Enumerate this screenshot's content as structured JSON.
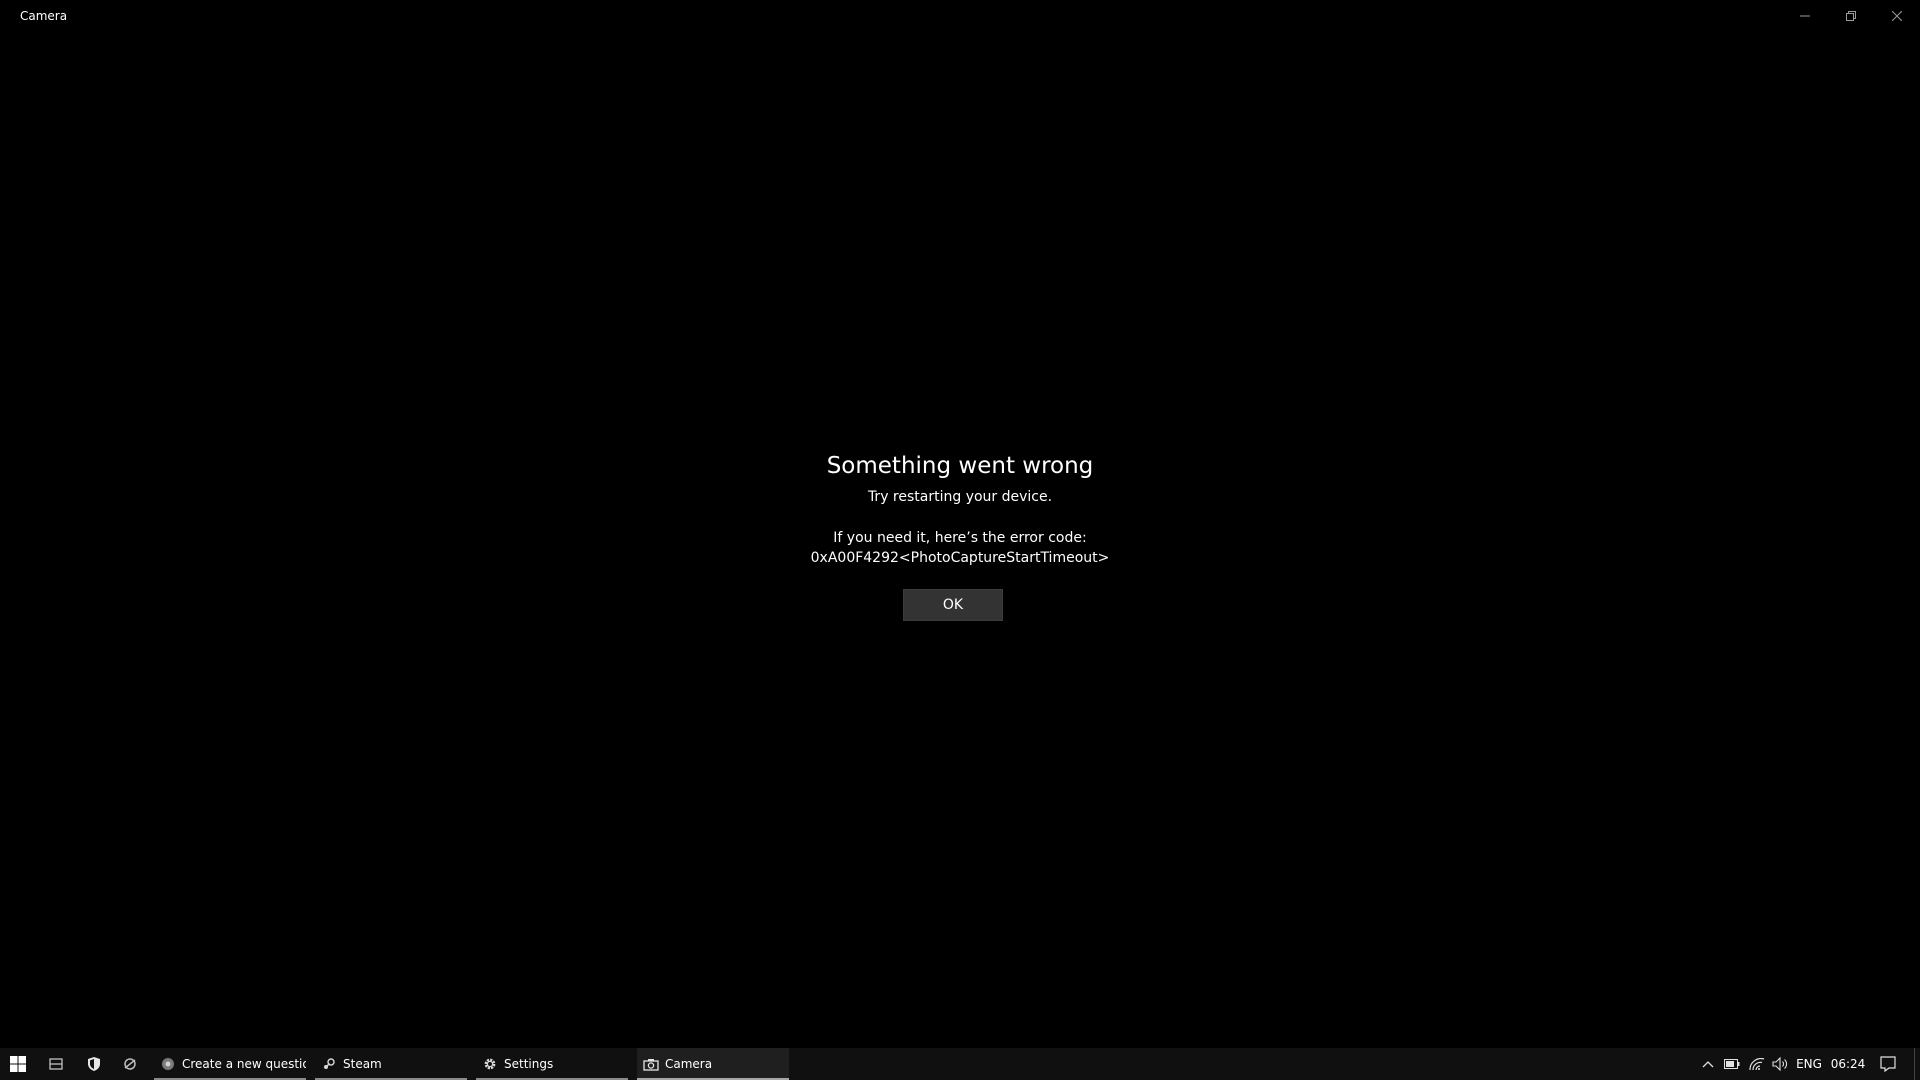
{
  "window": {
    "title": "Camera",
    "controls": {
      "minimize": "minimize-icon",
      "restore": "restore-icon",
      "close": "close-icon"
    }
  },
  "error": {
    "title": "Something went wrong",
    "subtitle": "Try restarting your device.",
    "code_label": "If you need it, here’s the error code:",
    "code": "0xA00F4292<PhotoCaptureStartTimeout>",
    "ok_label": "OK"
  },
  "taskbar": {
    "pinned": [
      {
        "icon": "windows-start-icon"
      },
      {
        "icon": "task-view-icon"
      },
      {
        "icon": "security-shield-icon"
      },
      {
        "icon": "app-icon"
      }
    ],
    "apps": [
      {
        "label": "Create a new questio...",
        "icon": "browser-icon",
        "active": false
      },
      {
        "label": "Steam",
        "icon": "steam-icon",
        "active": false
      },
      {
        "label": "Settings",
        "icon": "gear-icon",
        "active": false
      },
      {
        "label": "Camera",
        "icon": "camera-icon",
        "active": true
      }
    ],
    "tray": {
      "language": "ENG",
      "time": "06:24"
    }
  },
  "colors": {
    "background": "#000000",
    "taskbar": "#101010",
    "button": "#333333",
    "text": "#ffffff"
  }
}
